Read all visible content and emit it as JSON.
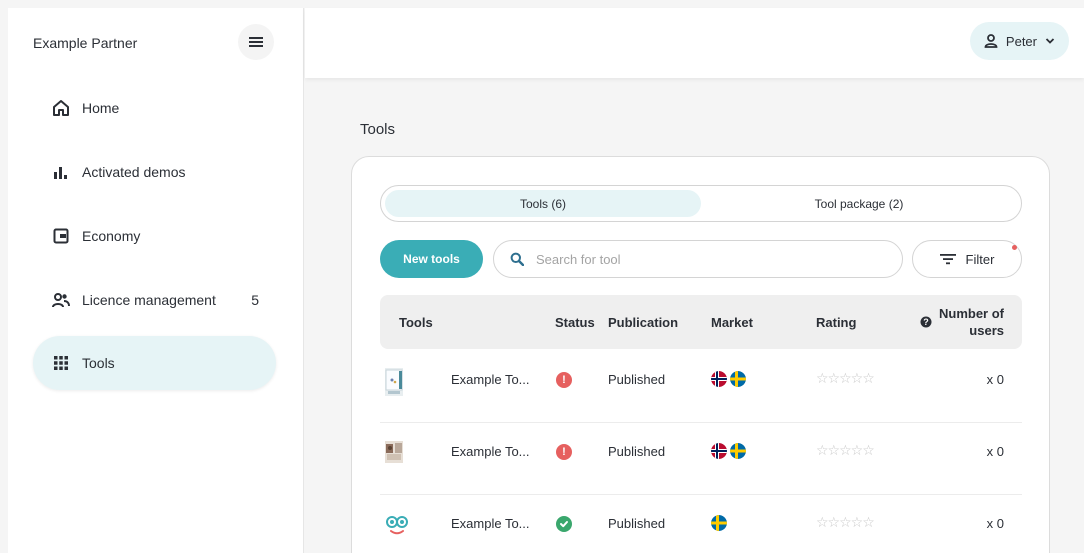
{
  "sidebar": {
    "brand": "Example Partner",
    "items": [
      {
        "label": "Home",
        "icon": "home-icon"
      },
      {
        "label": "Activated demos",
        "icon": "bar-chart-icon"
      },
      {
        "label": "Economy",
        "icon": "wallet-icon"
      },
      {
        "label": "Licence management",
        "icon": "users-icon",
        "badge": "5"
      },
      {
        "label": "Tools",
        "icon": "grid-icon",
        "active": true
      }
    ]
  },
  "header": {
    "user": "Peter"
  },
  "page": {
    "title": "Tools"
  },
  "tabs": [
    {
      "label": "Tools (6)",
      "active": true
    },
    {
      "label": "Tool package (2)"
    }
  ],
  "toolbar": {
    "new_label": "New tools",
    "search_placeholder": "Search for tool",
    "filter_label": "Filter"
  },
  "table": {
    "columns": [
      "Tools",
      "Status",
      "Publication",
      "Market",
      "Rating",
      "Number of users"
    ],
    "rows": [
      {
        "name": "Example To...",
        "status": "warning",
        "publication": "Published",
        "markets": [
          "NO",
          "SE"
        ],
        "rating": "☆☆☆☆☆",
        "users": "x 0"
      },
      {
        "name": "Example To...",
        "status": "warning",
        "publication": "Published",
        "markets": [
          "NO",
          "SE"
        ],
        "rating": "☆☆☆☆☆",
        "users": "x 0"
      },
      {
        "name": "Example To...",
        "status": "ok",
        "publication": "Published",
        "markets": [
          "SE"
        ],
        "rating": "☆☆☆☆☆",
        "users": "x 0"
      }
    ]
  },
  "colors": {
    "accent": "#3aadb6",
    "accent_light": "#e6f4f6",
    "warning": "#e6605f",
    "ok": "#3aa76d"
  }
}
